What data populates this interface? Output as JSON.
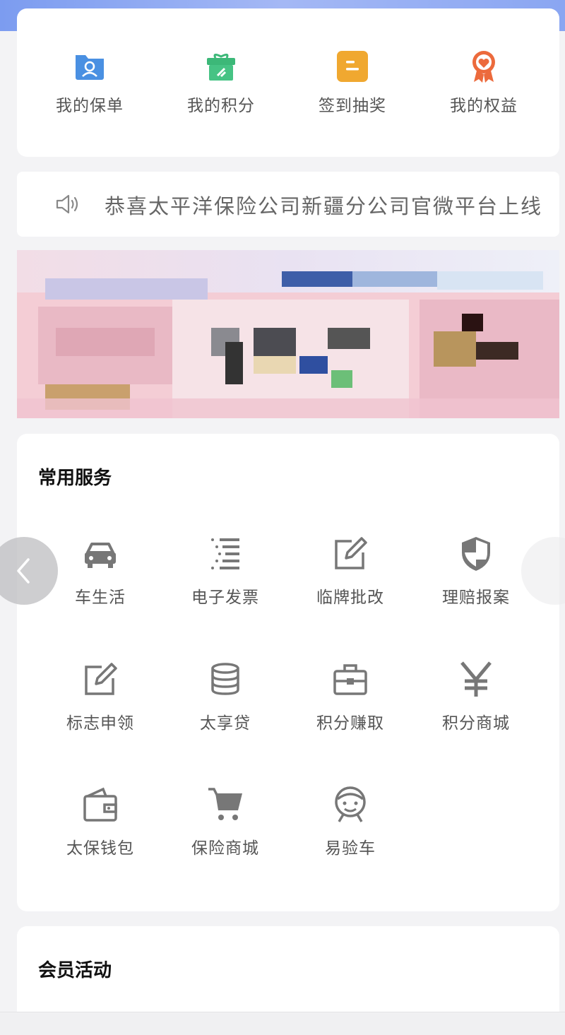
{
  "quick_actions": [
    {
      "label": "我的保单",
      "icon": "policy-folder-icon",
      "color": "#4a90e2"
    },
    {
      "label": "我的积分",
      "icon": "gift-box-icon",
      "color": "#3cb878"
    },
    {
      "label": "签到抽奖",
      "icon": "sign-in-icon",
      "color": "#f0a830"
    },
    {
      "label": "我的权益",
      "icon": "rights-medal-icon",
      "color": "#ec6a3c"
    }
  ],
  "notice": {
    "icon": "speaker-icon",
    "text": "恭喜太平洋保险公司新疆分公司官微平台上线"
  },
  "banner": {
    "icon": "promo-banner-image"
  },
  "services": {
    "title": "常用服务",
    "items": [
      {
        "label": "车生活",
        "icon": "car-icon"
      },
      {
        "label": "电子发票",
        "icon": "list-icon"
      },
      {
        "label": "临牌批改",
        "icon": "edit-icon"
      },
      {
        "label": "理赔报案",
        "icon": "shield-icon"
      },
      {
        "label": "标志申领",
        "icon": "edit-icon"
      },
      {
        "label": "太享贷",
        "icon": "database-icon"
      },
      {
        "label": "积分赚取",
        "icon": "toolbox-icon"
      },
      {
        "label": "积分商城",
        "icon": "yen-icon"
      },
      {
        "label": "太保钱包",
        "icon": "wallet-icon"
      },
      {
        "label": "保险商城",
        "icon": "cart-icon"
      },
      {
        "label": "易验车",
        "icon": "face-icon"
      }
    ]
  },
  "member": {
    "title": "会员活动"
  }
}
